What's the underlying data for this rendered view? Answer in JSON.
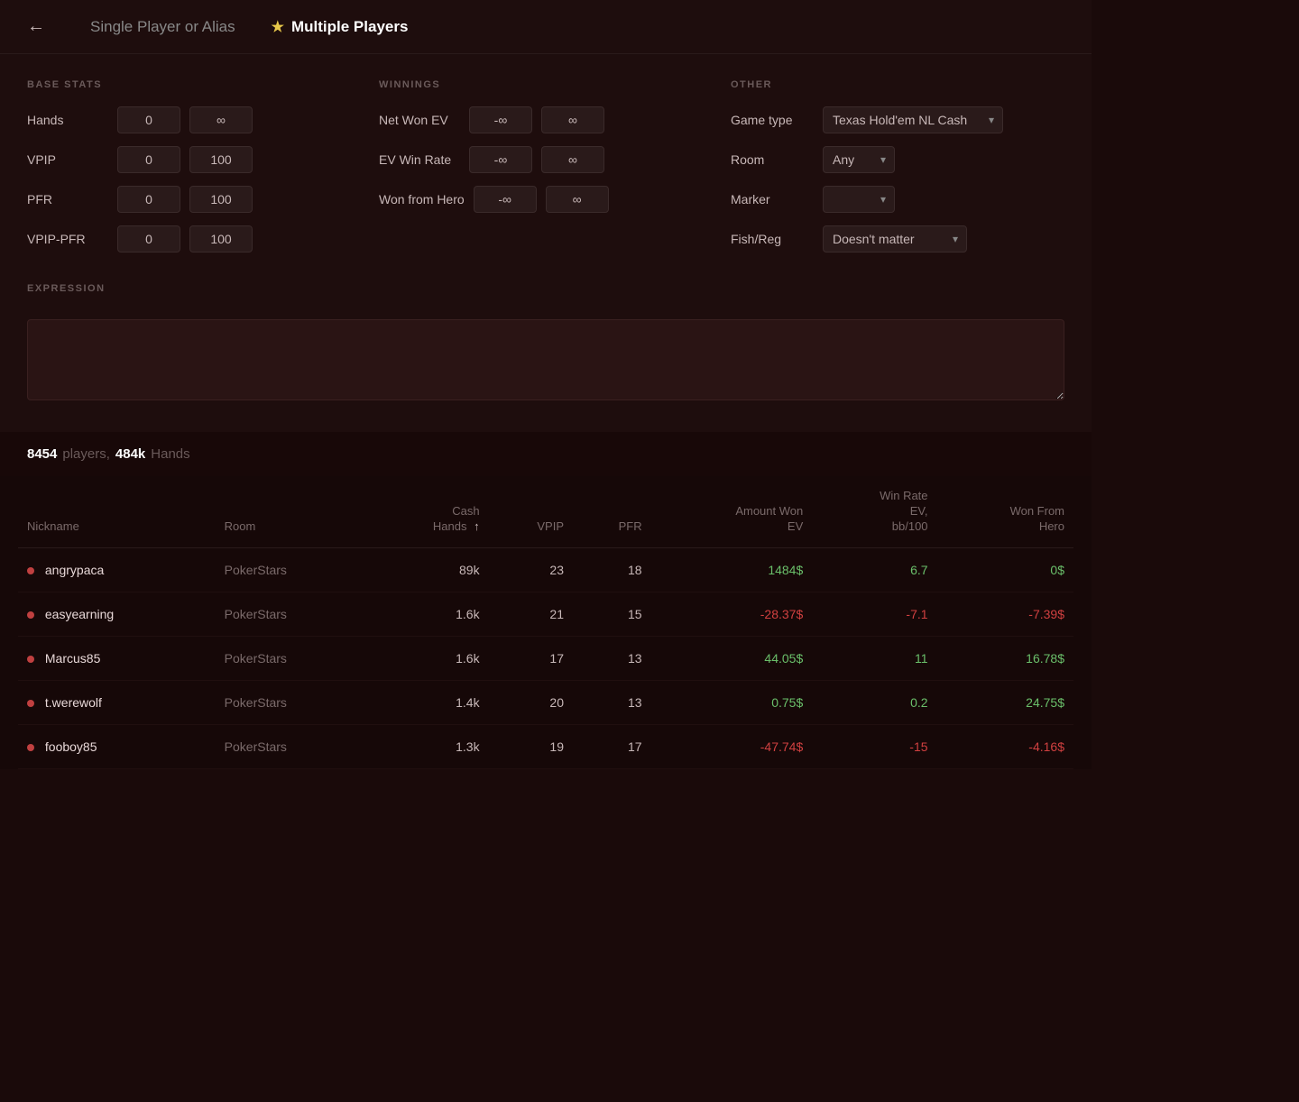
{
  "header": {
    "back_label": "←",
    "tab_single": "Single Player or Alias",
    "tab_multiple": "Multiple Players",
    "star": "★"
  },
  "filter": {
    "base_stats_title": "BASE STATS",
    "winnings_title": "WINNINGS",
    "other_title": "OTHER",
    "fields": {
      "hands_label": "Hands",
      "hands_min": "0",
      "hands_max": "∞",
      "vpip_label": "VPIP",
      "vpip_min": "0",
      "vpip_max": "100",
      "pfr_label": "PFR",
      "pfr_min": "0",
      "pfr_max": "100",
      "vpip_pfr_label": "VPIP-PFR",
      "vpip_pfr_min": "0",
      "vpip_pfr_max": "100",
      "net_won_ev_label": "Net Won EV",
      "net_won_ev_min": "-∞",
      "net_won_ev_max": "∞",
      "ev_win_rate_label": "EV Win Rate",
      "ev_win_rate_min": "-∞",
      "ev_win_rate_max": "∞",
      "won_from_hero_label": "Won from Hero",
      "won_from_hero_min": "-∞",
      "won_from_hero_max": "∞",
      "game_type_label": "Game type",
      "game_type_value": "Texas Hold'em NL Cash",
      "room_label": "Room",
      "room_value": "Any",
      "marker_label": "Marker",
      "marker_value": "",
      "fish_reg_label": "Fish/Reg",
      "fish_reg_value": "Doesn't matter"
    }
  },
  "expression": {
    "title": "EXPRESSION",
    "placeholder": ""
  },
  "stats_bar": {
    "players_count": "8454",
    "players_label": "players,",
    "hands_count": "484k",
    "hands_label": "Hands"
  },
  "table": {
    "columns": [
      {
        "id": "nickname",
        "label": "Nickname"
      },
      {
        "id": "room",
        "label": "Room"
      },
      {
        "id": "cash_hands",
        "label": "Cash\nHands",
        "sortable": true
      },
      {
        "id": "vpip",
        "label": "VPIP"
      },
      {
        "id": "pfr",
        "label": "PFR"
      },
      {
        "id": "amount_won_ev",
        "label": "Amount Won\nEV"
      },
      {
        "id": "win_rate_ev",
        "label": "Win Rate\nEV,\nbb/100"
      },
      {
        "id": "won_from_hero",
        "label": "Won From\nHero"
      }
    ],
    "rows": [
      {
        "nickname": "angrypaca",
        "room": "PokerStars",
        "cash_hands": "89k",
        "vpip": "23",
        "pfr": "18",
        "amount_won_ev": "1484$",
        "amount_won_ev_class": "positive",
        "win_rate_ev": "6.7",
        "win_rate_ev_class": "positive",
        "won_from_hero": "0$",
        "won_from_hero_class": "zero"
      },
      {
        "nickname": "easyearning",
        "room": "PokerStars",
        "cash_hands": "1.6k",
        "vpip": "21",
        "pfr": "15",
        "amount_won_ev": "-28.37$",
        "amount_won_ev_class": "negative",
        "win_rate_ev": "-7.1",
        "win_rate_ev_class": "negative",
        "won_from_hero": "-7.39$",
        "won_from_hero_class": "negative"
      },
      {
        "nickname": "Marcus85",
        "room": "PokerStars",
        "cash_hands": "1.6k",
        "vpip": "17",
        "pfr": "13",
        "amount_won_ev": "44.05$",
        "amount_won_ev_class": "positive",
        "win_rate_ev": "11",
        "win_rate_ev_class": "positive",
        "won_from_hero": "16.78$",
        "won_from_hero_class": "positive"
      },
      {
        "nickname": "t.werewolf",
        "room": "PokerStars",
        "cash_hands": "1.4k",
        "vpip": "20",
        "pfr": "13",
        "amount_won_ev": "0.75$",
        "amount_won_ev_class": "positive",
        "win_rate_ev": "0.2",
        "win_rate_ev_class": "positive",
        "won_from_hero": "24.75$",
        "won_from_hero_class": "positive"
      },
      {
        "nickname": "fooboy85",
        "room": "PokerStars",
        "cash_hands": "1.3k",
        "vpip": "19",
        "pfr": "17",
        "amount_won_ev": "-47.74$",
        "amount_won_ev_class": "negative",
        "win_rate_ev": "-15",
        "win_rate_ev_class": "negative",
        "won_from_hero": "-4.16$",
        "won_from_hero_class": "negative"
      }
    ]
  }
}
